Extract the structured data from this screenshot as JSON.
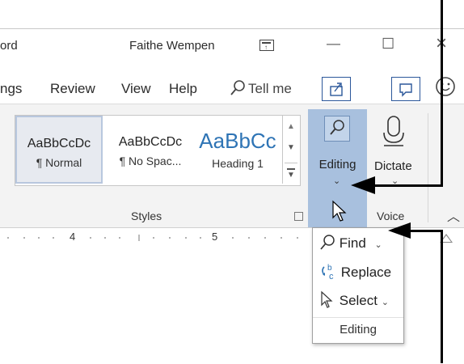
{
  "titlebar": {
    "doc_partial": "ord",
    "user": "Faithe Wempen",
    "minimize": "—",
    "maximize": "☐",
    "close": "×"
  },
  "tabs": {
    "partial": "ngs",
    "review": "Review",
    "view": "View",
    "help": "Help",
    "tell_me": "Tell me"
  },
  "styles": {
    "items": [
      {
        "sample": "AaBbCcDc",
        "name": "¶ Normal"
      },
      {
        "sample": "AaBbCcDc",
        "name": "¶ No Spac..."
      },
      {
        "sample": "AaBbCc",
        "name": "Heading 1"
      }
    ],
    "group_label": "Styles"
  },
  "editing": {
    "label": "Editing"
  },
  "dictate": {
    "label": "Dictate"
  },
  "voice": {
    "group_label": "Voice"
  },
  "ruler": {
    "mark4": "4",
    "mark5": "5"
  },
  "menu": {
    "find": "Find",
    "replace": "Replace",
    "select": "Select",
    "footer": "Editing"
  }
}
